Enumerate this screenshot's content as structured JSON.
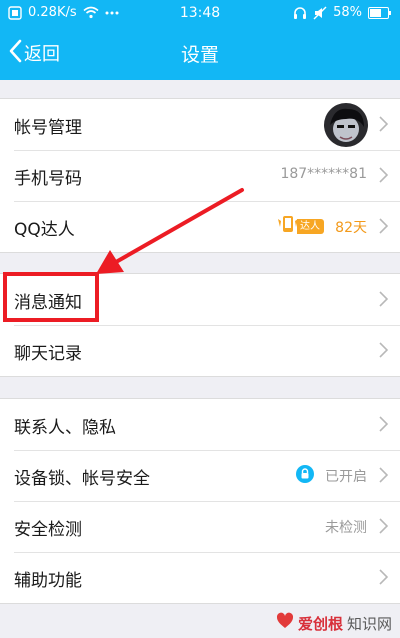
{
  "status_bar": {
    "speed": "0.28K/s",
    "time": "13:48",
    "battery": "58%"
  },
  "nav": {
    "back_label": "返回",
    "title": "设置"
  },
  "groups": [
    [
      {
        "label": "帐号管理"
      },
      {
        "label": "手机号码",
        "value": "187******81"
      },
      {
        "label": "QQ达人",
        "badge": "达人",
        "days": "82天"
      }
    ],
    [
      {
        "label": "消息通知"
      },
      {
        "label": "聊天记录"
      }
    ],
    [
      {
        "label": "联系人、隐私"
      },
      {
        "label": "设备锁、帐号安全",
        "value": "已开启"
      },
      {
        "label": "安全检测",
        "value": "未检测"
      },
      {
        "label": "辅助功能"
      }
    ]
  ],
  "watermark": {
    "red": "爱创根",
    "text": "知识网"
  },
  "colors": {
    "accent": "#12b7f5",
    "highlight": "#ec1c24",
    "qq_gold": "#f39a1b"
  }
}
